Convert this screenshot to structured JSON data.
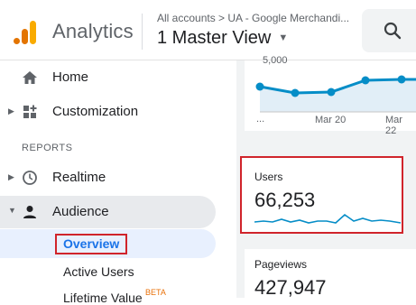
{
  "header": {
    "app_name": "Analytics",
    "breadcrumb": "All accounts > UA - Google Merchandi...",
    "view_name": "1 Master View",
    "view_caret": "▼",
    "logo_colors": [
      "#f9ab00",
      "#e37400"
    ]
  },
  "sidebar": {
    "home": "Home",
    "customization": "Customization",
    "reports_label": "REPORTS",
    "realtime": "Realtime",
    "audience": "Audience",
    "audience_sub": {
      "overview": "Overview",
      "active_users": "Active Users",
      "lifetime_value": "Lifetime Value",
      "lifetime_badge": "BETA"
    }
  },
  "chart": {
    "y_tick_label": "5,000",
    "x_labels": [
      "...",
      "Mar 20",
      "Mar 22"
    ],
    "line_color": "#058dc7",
    "fill_color": "#e1eef7"
  },
  "metrics": {
    "users_label": "Users",
    "users_value": "66,253",
    "pageviews_label": "Pageviews",
    "pageviews_value": "427,947"
  },
  "colors": {
    "highlight_border": "#d0242b",
    "selected_text": "#1a73e8"
  }
}
